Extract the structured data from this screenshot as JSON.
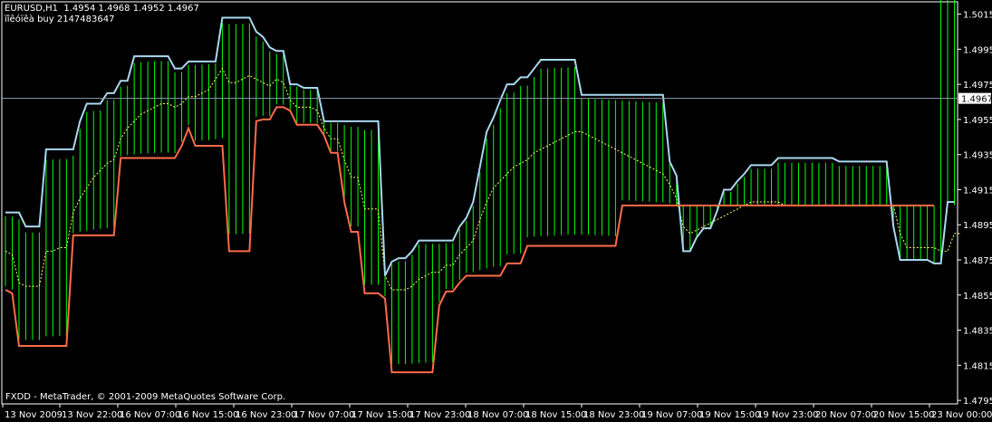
{
  "header": {
    "symbol_line": "EURUSD,H1  1.4954 1.4968 1.4952 1.4967",
    "indicator_line": "ïîêóïêà buy 2147483647"
  },
  "footer": {
    "copyright": "FXDD - MetaTrader, © 2001-2009 MetaQuotes Software Corp."
  },
  "colors": {
    "background": "#000000",
    "frame": "#ffffff",
    "bars": "#00ff00",
    "upper_band": "#a8d8f0",
    "lower_band": "#ff6a4a",
    "mid_line": "#ffff66",
    "price_line": "#8a9bb0"
  },
  "chart_data": {
    "type": "line",
    "ylim": [
      1.4793,
      1.5022
    ],
    "yticks": [
      "1.5015",
      "1.4995",
      "1.4975",
      "1.4955",
      "1.4935",
      "1.4915",
      "1.4895",
      "1.4875",
      "1.4855",
      "1.4835",
      "1.4815",
      "1.4795"
    ],
    "current_price": "1.4967",
    "xticks": [
      "13 Nov 2009",
      "13 Nov 22:00",
      "16 Nov 07:00",
      "16 Nov 15:00",
      "16 Nov 23:00",
      "17 Nov 07:00",
      "17 Nov 15:00",
      "17 Nov 23:00",
      "18 Nov 07:00",
      "18 Nov 15:00",
      "18 Nov 23:00",
      "19 Nov 07:00",
      "19 Nov 15:00",
      "19 Nov 23:00",
      "20 Nov 07:00",
      "20 Nov 15:00",
      "23 Nov 00:00"
    ],
    "series": [
      {
        "values": [
          1.4902,
          1.4902,
          1.4902,
          1.4894,
          1.4894,
          1.4894,
          1.4938,
          1.4938,
          1.4938,
          1.4938,
          1.4938,
          1.4954,
          1.4964,
          1.4964,
          1.4964,
          1.497,
          1.497,
          1.4977,
          1.4977,
          1.4991,
          1.4991,
          1.4991,
          1.4991,
          1.4991,
          1.4991,
          1.4984,
          1.4984,
          1.4988,
          1.4988,
          1.4988,
          1.4988,
          1.4988,
          1.5013,
          1.5013,
          1.5013,
          1.5013,
          1.5013,
          1.5005,
          1.5002,
          1.4996,
          1.4994,
          1.4994,
          1.4975,
          1.4975,
          1.4973,
          1.4973,
          1.4973,
          1.4954,
          1.4954,
          1.4954,
          1.4954,
          1.4954,
          1.4954,
          1.4954,
          1.4954,
          1.4954,
          1.4866,
          1.4874,
          1.4876,
          1.4876,
          1.488,
          1.4886,
          1.4886,
          1.4886,
          1.4886,
          1.4886,
          1.4886,
          1.4894,
          1.4899,
          1.4908,
          1.4928,
          1.4948,
          1.4956,
          1.4966,
          1.4975,
          1.4975,
          1.4979,
          1.4979,
          1.4984,
          1.4989,
          1.4989,
          1.4989,
          1.4989,
          1.4989,
          1.4989,
          1.4969,
          1.4969,
          1.4969,
          1.4969,
          1.4969,
          1.4969,
          1.4969,
          1.4969,
          1.4969,
          1.4969,
          1.4969,
          1.4969,
          1.4969,
          1.4931,
          1.4923,
          1.488,
          1.488,
          1.4888,
          1.4893,
          1.4893,
          1.4903,
          1.4915,
          1.4915,
          1.492,
          1.4924,
          1.4929,
          1.4929,
          1.4929,
          1.4929,
          1.4933,
          1.4933,
          1.4933,
          1.4933,
          1.4933,
          1.4933,
          1.4933,
          1.4933,
          1.4933,
          1.4931,
          1.4931,
          1.4931,
          1.4931,
          1.4931,
          1.4931,
          1.4931,
          1.4931,
          1.4894,
          1.4875,
          1.4875,
          1.4875,
          1.4875,
          1.4875,
          1.4873,
          1.4873,
          1.4908,
          1.4908
        ]
      },
      {
        "values": [
          1.4858,
          1.4856,
          1.4826,
          1.4826,
          1.4826,
          1.4826,
          1.4826,
          1.4826,
          1.4826,
          1.4826,
          1.4889,
          1.4889,
          1.4889,
          1.4889,
          1.4889,
          1.4889,
          1.4889,
          1.4933,
          1.4933,
          1.4933,
          1.4933,
          1.4933,
          1.4933,
          1.4933,
          1.4933,
          1.4933,
          1.494,
          1.495,
          1.494,
          1.494,
          1.494,
          1.494,
          1.494,
          1.488,
          1.488,
          1.488,
          1.488,
          1.4954,
          1.4955,
          1.4955,
          1.4962,
          1.4962,
          1.496,
          1.4952,
          1.4952,
          1.4952,
          1.4952,
          1.4946,
          1.4936,
          1.4936,
          1.4908,
          1.4891,
          1.4891,
          1.4856,
          1.4856,
          1.4856,
          1.4853,
          1.4811,
          1.4811,
          1.4811,
          1.4811,
          1.4811,
          1.4811,
          1.4811,
          1.4849,
          1.4857,
          1.4857,
          1.4862,
          1.4866,
          1.4866,
          1.4866,
          1.4866,
          1.4866,
          1.4866,
          1.4873,
          1.4873,
          1.4873,
          1.4883,
          1.4883,
          1.4883,
          1.4883,
          1.4883,
          1.4883,
          1.4883,
          1.4883,
          1.4883,
          1.4883,
          1.4883,
          1.4883,
          1.4883,
          1.4883,
          1.4906,
          1.4906,
          1.4906,
          1.4906,
          1.4906,
          1.4906,
          1.4906,
          1.4906,
          1.4906,
          1.4906,
          1.4906,
          1.4906,
          1.4906,
          1.4906,
          1.4906,
          1.4906,
          1.4906,
          1.4906,
          1.4906,
          1.4906,
          1.4906,
          1.4906,
          1.4906,
          1.4906,
          1.4906,
          1.4906,
          1.4906,
          1.4906,
          1.4906,
          1.4906,
          1.4906,
          1.4906,
          1.4906,
          1.4906,
          1.4906,
          1.4906,
          1.4906,
          1.4906,
          1.4906,
          1.4906,
          1.4906,
          1.4906,
          1.4906,
          1.4906,
          1.4906,
          1.4906,
          1.4906
        ]
      },
      {
        "values": [
          1.488,
          1.4878,
          1.4862,
          1.486,
          1.486,
          1.486,
          1.488,
          1.488,
          1.4882,
          1.4882,
          1.4902,
          1.491,
          1.4916,
          1.4922,
          1.4926,
          1.493,
          1.4932,
          1.4944,
          1.495,
          1.4954,
          1.4958,
          1.496,
          1.4962,
          1.4964,
          1.4964,
          1.4962,
          1.4964,
          1.4968,
          1.4968,
          1.497,
          1.4972,
          1.4978,
          1.4984,
          1.4976,
          1.4976,
          1.4978,
          1.498,
          1.4978,
          1.4976,
          1.4974,
          1.4978,
          1.4976,
          1.4966,
          1.4962,
          1.4962,
          1.4962,
          1.496,
          1.495,
          1.4944,
          1.4944,
          1.4932,
          1.4922,
          1.4922,
          1.4904,
          1.4904,
          1.4904,
          1.4866,
          1.4858,
          1.4858,
          1.4858,
          1.486,
          1.4864,
          1.4866,
          1.4868,
          1.4868,
          1.4872,
          1.4872,
          1.4878,
          1.4882,
          1.4886,
          1.4898,
          1.4908,
          1.4916,
          1.492,
          1.4924,
          1.4928,
          1.493,
          1.4932,
          1.4936,
          1.4938,
          1.494,
          1.4942,
          1.4944,
          1.4946,
          1.4948,
          1.4948,
          1.4946,
          1.4944,
          1.4942,
          1.494,
          1.4938,
          1.4936,
          1.4934,
          1.4932,
          1.493,
          1.4928,
          1.4926,
          1.4924,
          1.4918,
          1.491,
          1.4894,
          1.489,
          1.4892,
          1.4894,
          1.4896,
          1.4898,
          1.49,
          1.4902,
          1.4904,
          1.4906,
          1.4908,
          1.4908,
          1.4908,
          1.4908,
          1.4908,
          1.4906,
          1.4906,
          1.4906,
          1.4906,
          1.4906,
          1.4906,
          1.4906,
          1.4906,
          1.4906,
          1.4906,
          1.4906,
          1.4906,
          1.4906,
          1.4906,
          1.4906,
          1.4906,
          1.4906,
          1.489,
          1.4882,
          1.4882,
          1.4882,
          1.4882,
          1.4882,
          1.488,
          1.488,
          1.489,
          1.489
        ]
      }
    ]
  }
}
